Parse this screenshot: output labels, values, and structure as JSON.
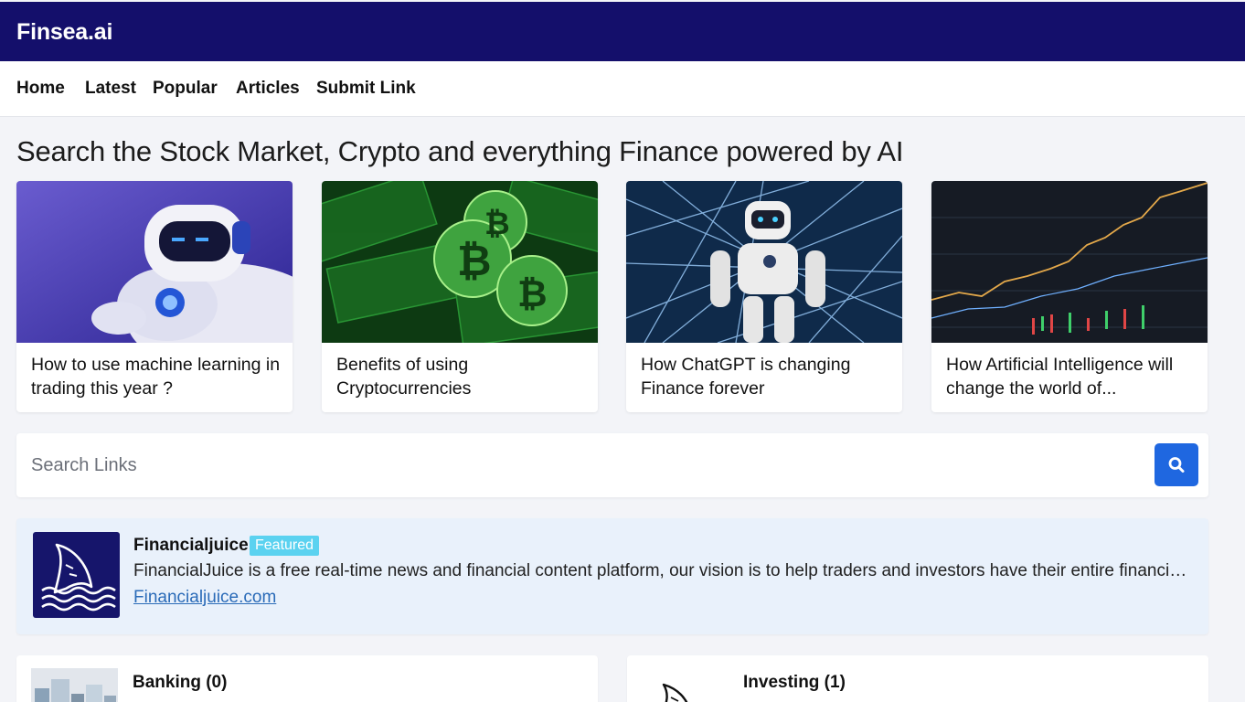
{
  "header": {
    "brand": "Finsea.ai",
    "color": "#140f6b"
  },
  "nav": {
    "items": [
      "Home",
      "Latest",
      "Popular",
      "Articles",
      "Submit Link"
    ]
  },
  "headline": "Search the Stock Market, Crypto and everything Finance powered by AI",
  "articles": [
    {
      "title": "How to use machine learning in trading this year ?",
      "image": "robot-image"
    },
    {
      "title": "Benefits of using Cryptocurrencies",
      "image": "bitcoin-image"
    },
    {
      "title": "How ChatGPT is changing Finance forever",
      "image": "robot-network-image"
    },
    {
      "title": "How Artificial Intelligence will change the world of...",
      "image": "stock-chart-image"
    }
  ],
  "search": {
    "placeholder": "Search Links",
    "button_icon": "search-icon",
    "button_color": "#1f67e0"
  },
  "featured": {
    "name": "Financialjuice",
    "badge": "Featured",
    "description": "FinancialJuice is a free real-time news and financial content platform, our vision is to help traders and investors have their entire financial...",
    "link": "Financialjuice.com",
    "logo_icon": "shark-fin-icon",
    "badge_color": "#5bd2f0"
  },
  "categories": [
    {
      "title": "Banking (0)",
      "image": "city-skyline-image"
    },
    {
      "title": "Investing (1)",
      "image": "shark-fin-icon"
    }
  ]
}
